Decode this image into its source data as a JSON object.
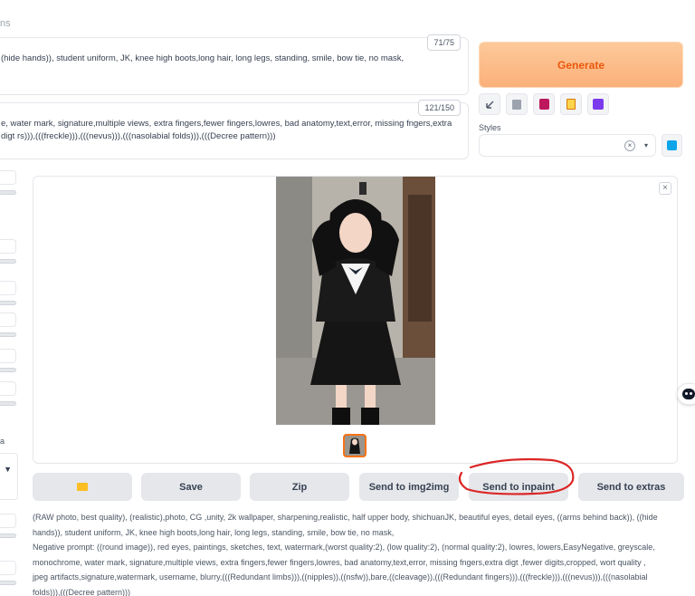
{
  "top_tab": "ns",
  "prompt": {
    "counter": "71/75",
    "text": "(hide hands)), student uniform, JK, knee high boots,long hair, long legs, standing, smile, bow tie, no mask,"
  },
  "negative_prompt": {
    "counter": "121/150",
    "text": "e, water mark, signature,multiple views, extra fingers,fewer fingers,lowres, bad anatomy,text,error, missing fngers,extra digt rs))),(((freckle))),(((nevus))),(((nasolabial folds))),(((Decree pattern)))"
  },
  "generate_label": "Generate",
  "tools": [
    "arrow-icon",
    "trash-icon",
    "pink-book-icon",
    "clipboard-icon",
    "save-disk-icon"
  ],
  "styles": {
    "label": "Styles",
    "clear": "×",
    "caret": "▾"
  },
  "left_panel": {
    "letter": "a",
    "caret": "▼"
  },
  "gallery": {
    "close": "×"
  },
  "actions": {
    "save": "Save",
    "zip": "Zip",
    "img2img": "Send to img2img",
    "inpaint": "Send to inpaint",
    "extras": "Send to extras"
  },
  "info": {
    "line1": "(RAW photo, best quality), (realistic),photo, CG ,unity, 2k wallpaper, sharpening,realistic, half upper body, shichuanJK, beautiful eyes, detail eyes, ((arms behind back)), ((hide",
    "line2": "hands)), student uniform, JK, knee high boots,long hair, long legs, standing, smile, bow tie, no mask,",
    "line3": "Negative prompt: ((round image)), red eyes, paintings, sketches, text, watermark,(worst quality:2), (low quality:2), (normal quality:2), lowres, lowers,EasyNegative, greyscale,",
    "line4": "monochrome, water mark, signature,multiple views, extra fingers,fewer fingers,lowres, bad anatomy,text,error, missing fngers,extra digt ,fewer digits,cropped, wort quality ,",
    "line5": "jpeg artifacts,signature,watermark, username, blurry,(((Redundant limbs))),((nipples)),((nsfw)),bare,((cleavage)),(((Redundant fingers))),(((freckle))),(((nevus))),(((nasolabial",
    "line6": "folds))),(((Decree pattern)))"
  },
  "colors": {
    "generate_text": "#ea580c",
    "generate_bg": "#fbb07a",
    "thumb_border": "#f97316",
    "annotation": "#dc2626"
  }
}
